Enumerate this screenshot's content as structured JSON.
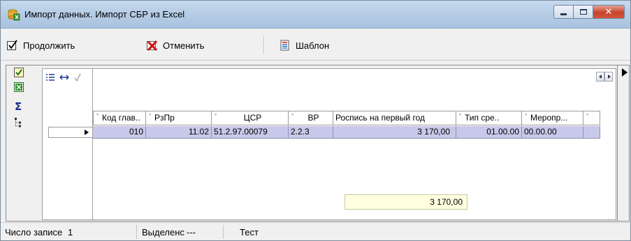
{
  "window": {
    "title": "Импорт данных. Импорт СБР из Excel",
    "controls": [
      "minimize",
      "maximize",
      "close"
    ]
  },
  "toolbar": {
    "continue_label": "Продолжить",
    "cancel_label": "Отменить",
    "template_label": "Шаблон"
  },
  "side_tools": [
    "checklist-icon",
    "excel-icon",
    "sum-icon",
    "tree-icon"
  ],
  "grid": {
    "columns": [
      {
        "label": "Код глав..",
        "marker": true
      },
      {
        "label": "РзПр",
        "marker": true
      },
      {
        "label": "ЦСР",
        "marker": true
      },
      {
        "label": "ВР",
        "marker": true
      },
      {
        "label": "Роспись на первый год",
        "marker": false
      },
      {
        "label": "Тип сре..",
        "marker": true
      },
      {
        "label": "Меропр...",
        "marker": true
      },
      {
        "label": "",
        "marker": true
      }
    ],
    "rows": [
      [
        "010",
        "11.02",
        "51.2.97.00079",
        "2.2.3",
        "3 170,00",
        "01.00.00",
        "00.00.00",
        ""
      ]
    ],
    "total": "3 170,00"
  },
  "status": {
    "records_label": "Число записе",
    "records_value": "1",
    "selected_label": "Выделенс",
    "selected_value": "---",
    "mode_label": "Тест"
  },
  "colors": {
    "selected_row": "#c8c8ea",
    "total_bg": "#ffffe0",
    "titlebar": "#b7cde6",
    "close_button": "#c7422a"
  }
}
